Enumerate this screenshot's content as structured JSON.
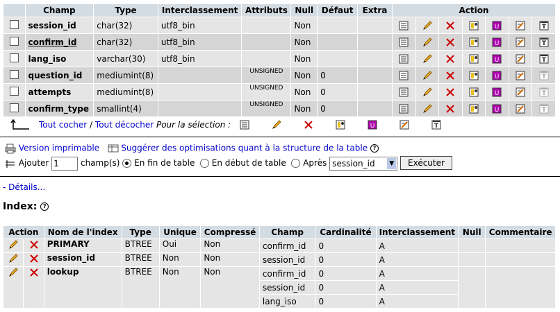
{
  "columns_header": [
    "Champ",
    "Type",
    "Interclassement",
    "Attributs",
    "Null",
    "Défaut",
    "Extra",
    "Action"
  ],
  "rows": [
    {
      "name": "session_id",
      "type": "char(32)",
      "collation": "utf8_bin",
      "attr": "",
      "null": "Non",
      "default": "",
      "extra": "",
      "underlined": false
    },
    {
      "name": "confirm_id",
      "type": "char(32)",
      "collation": "utf8_bin",
      "attr": "",
      "null": "Non",
      "default": "",
      "extra": "",
      "underlined": true
    },
    {
      "name": "lang_iso",
      "type": "varchar(30)",
      "collation": "utf8_bin",
      "attr": "",
      "null": "Non",
      "default": "",
      "extra": "",
      "underlined": false
    },
    {
      "name": "question_id",
      "type": "mediumint(8)",
      "collation": "",
      "attr": "UNSIGNED",
      "null": "Non",
      "default": "0",
      "extra": "",
      "underlined": false
    },
    {
      "name": "attempts",
      "type": "mediumint(8)",
      "collation": "",
      "attr": "UNSIGNED",
      "null": "Non",
      "default": "0",
      "extra": "",
      "underlined": false
    },
    {
      "name": "confirm_type",
      "type": "smallint(4)",
      "collation": "",
      "attr": "UNSIGNED",
      "null": "Non",
      "default": "0",
      "extra": "",
      "underlined": false
    }
  ],
  "select_bar": {
    "check_all": "Tout cocher",
    "separator": "/",
    "uncheck_all": "Tout décocher",
    "for_selection": "Pour la sélection :"
  },
  "links": {
    "print_view": "Version imprimable",
    "propose": "Suggérer des optimisations quant à la structure de la table"
  },
  "add_field": {
    "label": "Ajouter",
    "count": "1",
    "suffix": "champ(s)",
    "opt_end": "En fin de table",
    "opt_begin": "En début de table",
    "opt_after": "Après",
    "after_field": "session_id",
    "execute": "Exécuter"
  },
  "details_link": "- Détails...",
  "index_title": "Index:",
  "index_header": [
    "Action",
    "Nom de l'index",
    "Type",
    "Unique",
    "Compressé",
    "Champ",
    "Cardinalité",
    "Interclassement",
    "Null",
    "Commentaire"
  ],
  "indexes": [
    {
      "name": "PRIMARY",
      "type": "BTREE",
      "unique": "Oui",
      "packed": "Non",
      "cols": [
        {
          "field": "confirm_id",
          "card": "0",
          "coll": "A"
        }
      ]
    },
    {
      "name": "session_id",
      "type": "BTREE",
      "unique": "Non",
      "packed": "Non",
      "cols": [
        {
          "field": "session_id",
          "card": "0",
          "coll": "A"
        }
      ]
    },
    {
      "name": "lookup",
      "type": "BTREE",
      "unique": "Non",
      "packed": "Non",
      "cols": [
        {
          "field": "confirm_id",
          "card": "0",
          "coll": "A"
        },
        {
          "field": "session_id",
          "card": "0",
          "coll": "A"
        },
        {
          "field": "lang_iso",
          "card": "0",
          "coll": "A"
        }
      ]
    }
  ],
  "colors": {
    "header_bg": "#d3dce3",
    "row_odd": "#e5e5e5",
    "row_even": "#d5d5d5",
    "link": "#0000cc",
    "delete_red": "#cc0000"
  }
}
